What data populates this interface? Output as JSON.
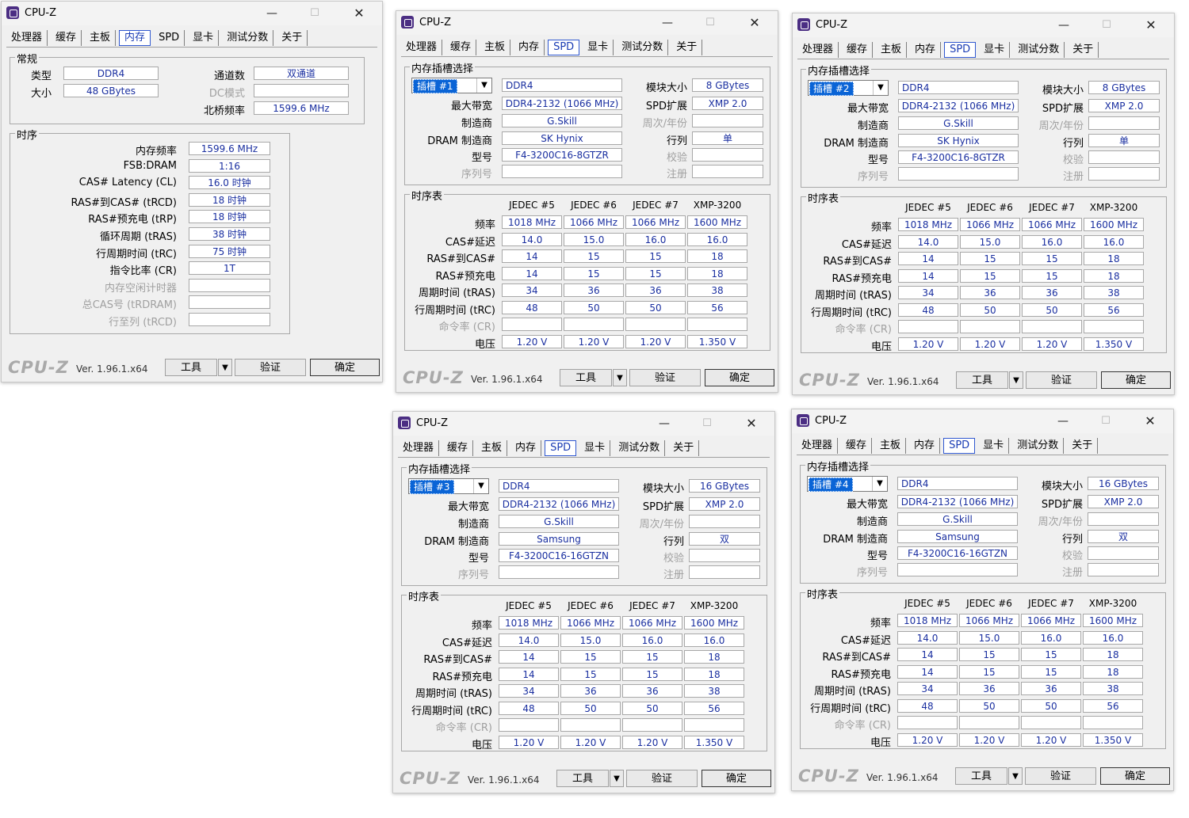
{
  "app_title": "CPU-Z",
  "title_controls": {
    "minimize": "—",
    "maximize": "☐",
    "close": "✕"
  },
  "tabs": [
    "处理器",
    "缓存",
    "主板",
    "内存",
    "SPD",
    "显卡",
    "测试分数",
    "关于"
  ],
  "footer": {
    "logo": "CPU-Z",
    "version": "Ver. 1.96.1.x64",
    "tools": "工具",
    "tools_arrow": "▼",
    "validate": "验证",
    "ok": "确定"
  },
  "memory": {
    "active_tab": "内存",
    "general": {
      "title": "常规",
      "type_label": "类型",
      "type_value": "DDR4",
      "size_label": "大小",
      "size_value": "48 GBytes",
      "channels_label": "通道数",
      "channels_value": "双通道",
      "dc_label": "DC模式",
      "dc_value": "",
      "nb_label": "北桥频率",
      "nb_value": "1599.6 MHz"
    },
    "timings": {
      "title": "时序",
      "rows": [
        {
          "label": "内存频率",
          "value": "1599.6 MHz",
          "dim": false
        },
        {
          "label": "FSB:DRAM",
          "value": "1:16",
          "dim": false
        },
        {
          "label": "CAS# Latency (CL)",
          "value": "16.0 时钟",
          "dim": false
        },
        {
          "label": "RAS#到CAS# (tRCD)",
          "value": "18 时钟",
          "dim": false
        },
        {
          "label": "RAS#预充电 (tRP)",
          "value": "18 时钟",
          "dim": false
        },
        {
          "label": "循环周期 (tRAS)",
          "value": "38 时钟",
          "dim": false
        },
        {
          "label": "行周期时间 (tRC)",
          "value": "75 时钟",
          "dim": false
        },
        {
          "label": "指令比率 (CR)",
          "value": "1T",
          "dim": false
        },
        {
          "label": "内存空闲计时器",
          "value": "",
          "dim": true
        },
        {
          "label": "总CAS号 (tRDRAM)",
          "value": "",
          "dim": true
        },
        {
          "label": "行至列 (tRCD)",
          "value": "",
          "dim": true
        }
      ]
    }
  },
  "spd_labels": {
    "active_tab": "SPD",
    "slot_title": "内存插槽选择",
    "max_bw": "最大带宽",
    "manufacturer": "制造商",
    "dram_mfr": "DRAM 制造商",
    "part": "型号",
    "serial": "序列号",
    "module_size": "模块大小",
    "spd_ext": "SPD扩展",
    "week_year": "周次/年份",
    "ranks": "行列",
    "correction": "校验",
    "registered": "注册",
    "timing_title": "时序表",
    "col_headers": [
      "JEDEC #5",
      "JEDEC #6",
      "JEDEC #7",
      "XMP-3200"
    ],
    "row_labels": [
      "频率",
      "CAS#延迟",
      "RAS#到CAS#",
      "RAS#预充电",
      "周期时间 (tRAS)",
      "行周期时间 (tRC)",
      "命令率 (CR)",
      "电压"
    ]
  },
  "spd_slots": [
    {
      "slot": "插槽 #1",
      "type": "DDR4",
      "module_size": "8 GBytes",
      "max_bw": "DDR4-2132 (1066 MHz)",
      "spd_ext": "XMP 2.0",
      "manufacturer": "G.Skill",
      "week_year": "",
      "dram_mfr": "SK Hynix",
      "ranks": "单",
      "part": "F4-3200C16-8GTZR",
      "correction": "",
      "serial": "",
      "registered": "",
      "timing_rows": [
        [
          "1018 MHz",
          "1066 MHz",
          "1066 MHz",
          "1600 MHz"
        ],
        [
          "14.0",
          "15.0",
          "16.0",
          "16.0"
        ],
        [
          "14",
          "15",
          "15",
          "18"
        ],
        [
          "14",
          "15",
          "15",
          "18"
        ],
        [
          "34",
          "36",
          "36",
          "38"
        ],
        [
          "48",
          "50",
          "50",
          "56"
        ],
        [
          "",
          "",
          "",
          ""
        ],
        [
          "1.20 V",
          "1.20 V",
          "1.20 V",
          "1.350 V"
        ]
      ]
    },
    {
      "slot": "插槽 #2",
      "type": "DDR4",
      "module_size": "8 GBytes",
      "max_bw": "DDR4-2132 (1066 MHz)",
      "spd_ext": "XMP 2.0",
      "manufacturer": "G.Skill",
      "week_year": "",
      "dram_mfr": "SK Hynix",
      "ranks": "单",
      "part": "F4-3200C16-8GTZR",
      "correction": "",
      "serial": "",
      "registered": "",
      "timing_rows": [
        [
          "1018 MHz",
          "1066 MHz",
          "1066 MHz",
          "1600 MHz"
        ],
        [
          "14.0",
          "15.0",
          "16.0",
          "16.0"
        ],
        [
          "14",
          "15",
          "15",
          "18"
        ],
        [
          "14",
          "15",
          "15",
          "18"
        ],
        [
          "34",
          "36",
          "36",
          "38"
        ],
        [
          "48",
          "50",
          "50",
          "56"
        ],
        [
          "",
          "",
          "",
          ""
        ],
        [
          "1.20 V",
          "1.20 V",
          "1.20 V",
          "1.350 V"
        ]
      ]
    },
    {
      "slot": "插槽 #3",
      "type": "DDR4",
      "module_size": "16 GBytes",
      "max_bw": "DDR4-2132 (1066 MHz)",
      "spd_ext": "XMP 2.0",
      "manufacturer": "G.Skill",
      "week_year": "",
      "dram_mfr": "Samsung",
      "ranks": "双",
      "part": "F4-3200C16-16GTZN",
      "correction": "",
      "serial": "",
      "registered": "",
      "timing_rows": [
        [
          "1018 MHz",
          "1066 MHz",
          "1066 MHz",
          "1600 MHz"
        ],
        [
          "14.0",
          "15.0",
          "16.0",
          "16.0"
        ],
        [
          "14",
          "15",
          "15",
          "18"
        ],
        [
          "14",
          "15",
          "15",
          "18"
        ],
        [
          "34",
          "36",
          "36",
          "38"
        ],
        [
          "48",
          "50",
          "50",
          "56"
        ],
        [
          "",
          "",
          "",
          ""
        ],
        [
          "1.20 V",
          "1.20 V",
          "1.20 V",
          "1.350 V"
        ]
      ]
    },
    {
      "slot": "插槽 #4",
      "type": "DDR4",
      "module_size": "16 GBytes",
      "max_bw": "DDR4-2132 (1066 MHz)",
      "spd_ext": "XMP 2.0",
      "manufacturer": "G.Skill",
      "week_year": "",
      "dram_mfr": "Samsung",
      "ranks": "双",
      "part": "F4-3200C16-16GTZN",
      "correction": "",
      "serial": "",
      "registered": "",
      "timing_rows": [
        [
          "1018 MHz",
          "1066 MHz",
          "1066 MHz",
          "1600 MHz"
        ],
        [
          "14.0",
          "15.0",
          "16.0",
          "16.0"
        ],
        [
          "14",
          "15",
          "15",
          "18"
        ],
        [
          "14",
          "15",
          "15",
          "18"
        ],
        [
          "34",
          "36",
          "36",
          "38"
        ],
        [
          "48",
          "50",
          "50",
          "56"
        ],
        [
          "",
          "",
          "",
          ""
        ],
        [
          "1.20 V",
          "1.20 V",
          "1.20 V",
          "1.350 V"
        ]
      ]
    }
  ]
}
